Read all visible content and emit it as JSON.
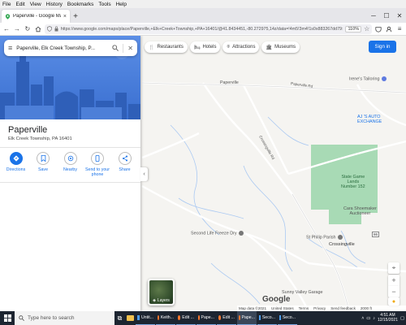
{
  "menubar": {
    "items": [
      "File",
      "Edit",
      "View",
      "History",
      "Bookmarks",
      "Tools",
      "Help"
    ]
  },
  "tab": {
    "title": "Paperville - Google Maps",
    "close": "×",
    "new": "+"
  },
  "window": {
    "minimize": "─",
    "maximize": "☐",
    "close": "✕"
  },
  "nav": {
    "url": "https://www.google.com/maps/place/Paperville,+Elk+Creek+Township,+PA+16401/@41.8434451,-80.272975,14z/data=!4m5!3m4!1s0x883267dd79:",
    "zoom": "110%"
  },
  "search": {
    "query": "Paperville, Elk Creek Township, P..."
  },
  "place": {
    "title": "Paperville",
    "subtitle": "Elk Creek Township, PA 16401"
  },
  "actions": [
    {
      "label": "Directions"
    },
    {
      "label": "Save"
    },
    {
      "label": "Nearby"
    },
    {
      "label": "Send to your phone"
    },
    {
      "label": "Share"
    }
  ],
  "chips": [
    "Restaurants",
    "Hotels",
    "Attractions",
    "Museums"
  ],
  "signin": "Sign in",
  "map_labels": {
    "paperville": "Paperville",
    "paperville_rd": "Paperville Rd",
    "crossingville_rd": "Crossingville Rd",
    "irene": "Irene's Tailoring",
    "aj_line1": "AJ 'S AUTO",
    "aj_line2": "EXCHANGE",
    "sgl_line1": "State Game",
    "sgl_line2": "Lands",
    "sgl_line3": "Number 152",
    "cara_line1": "Cara Shoemaker",
    "cara_line2": "Auctioneer",
    "second_life": "Second Life Freeze Dry",
    "philip": "St Philip Parish",
    "crossingville": "Crossingville",
    "sunny": "Sunny Valley Garage",
    "route": "86"
  },
  "layers": "Layers",
  "google": "Google",
  "footer": [
    "Map data ©2021",
    "United States",
    "Terms",
    "Privacy",
    "Send feedback",
    "2000 ft"
  ],
  "taskbar": {
    "search_placeholder": "Type here to search",
    "tasks": [
      "Untit...",
      "Keith...",
      "Edit ...",
      "Pape...",
      "Edit ...",
      "Pape...",
      "Seco...",
      "Seco..."
    ],
    "time": "4:51 AM",
    "date": "12/15/2021"
  },
  "colors": {
    "accent": "#1a73e8",
    "park": "#a8dab5",
    "taskbar": "#1d2531"
  }
}
